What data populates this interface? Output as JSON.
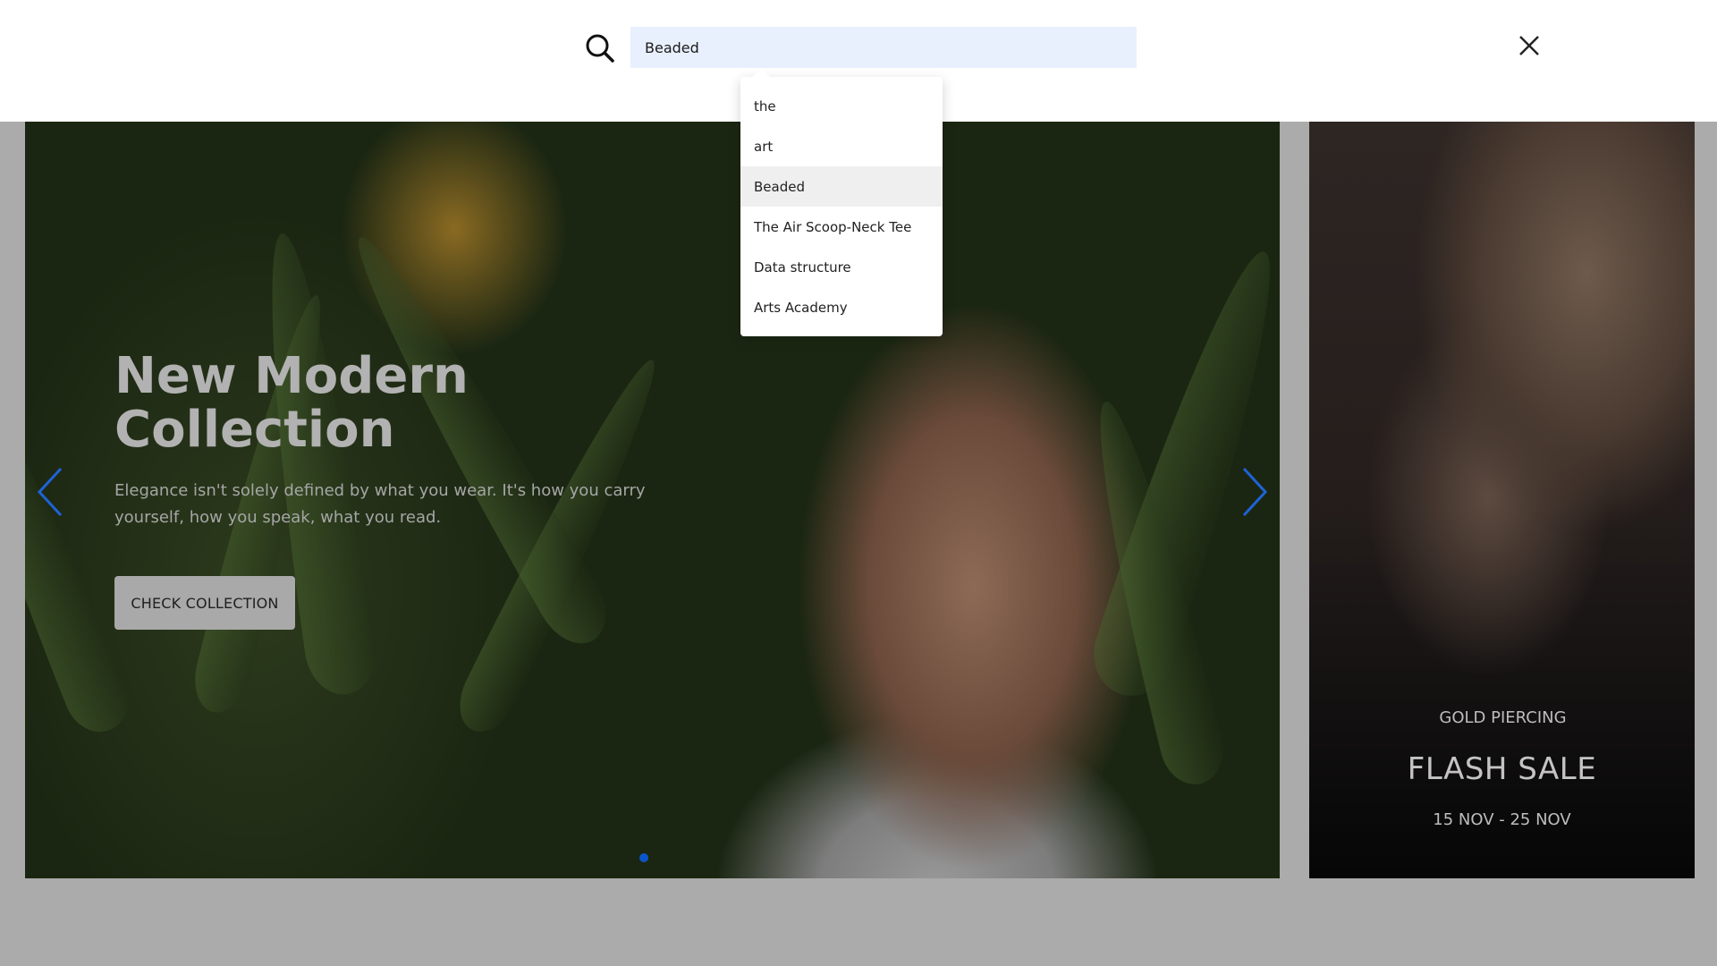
{
  "search": {
    "value": "Beaded",
    "suggestions": [
      {
        "label": "the"
      },
      {
        "label": "art"
      },
      {
        "label": "Beaded",
        "active": true
      },
      {
        "label": "The Air Scoop-Neck Tee"
      },
      {
        "label": "Data structure"
      },
      {
        "label": "Arts Academy"
      }
    ]
  },
  "hero": {
    "title_line1": "New Modern",
    "title_line2": "Collection",
    "text": "Elegance isn't solely defined by what you wear. It's how you carry yourself, how you speak, what you read.",
    "cta_label": "CHECK COLLECTION",
    "slide_indicator_color": "#0a56c9",
    "arrow_color": "#1e63d6"
  },
  "side_banner": {
    "eyebrow": "GOLD PIERCING",
    "title": "FLASH SALE",
    "dates": "15 NOV - 25 NOV"
  },
  "colors": {
    "search_input_bg": "#e8f0fe",
    "overlay_bg": "#ffffff",
    "page_dim_bg": "#ababab"
  }
}
